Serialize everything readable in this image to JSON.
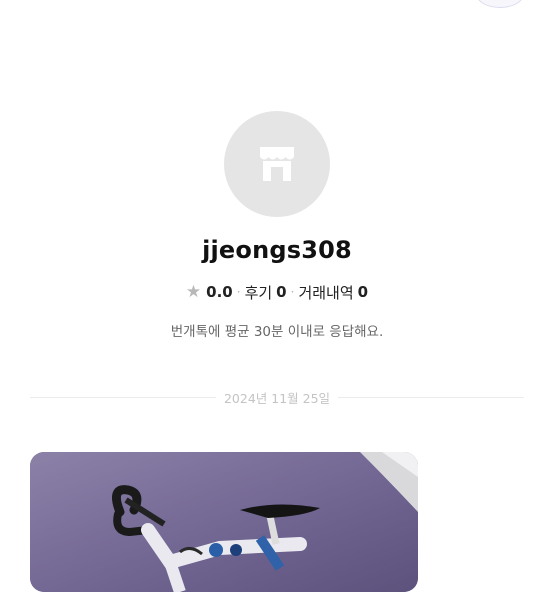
{
  "profile": {
    "username": "jjeongs308",
    "rating": "0.0",
    "reviews_label": "후기",
    "reviews_count": "0",
    "transactions_label": "거래내역",
    "transactions_count": "0",
    "separator": "·",
    "response_time": "번개톡에 평균 30분 이내로 응답해요.",
    "avatar_icon": "store-icon"
  },
  "chat": {
    "date_divider": "2024년 11월 25일",
    "message_image_alt": "bicycle photo"
  },
  "colors": {
    "avatar_bg": "#e5e5e5",
    "icon": "#ffffff",
    "muted_text": "#666666",
    "date_text": "#c4c4c4"
  }
}
